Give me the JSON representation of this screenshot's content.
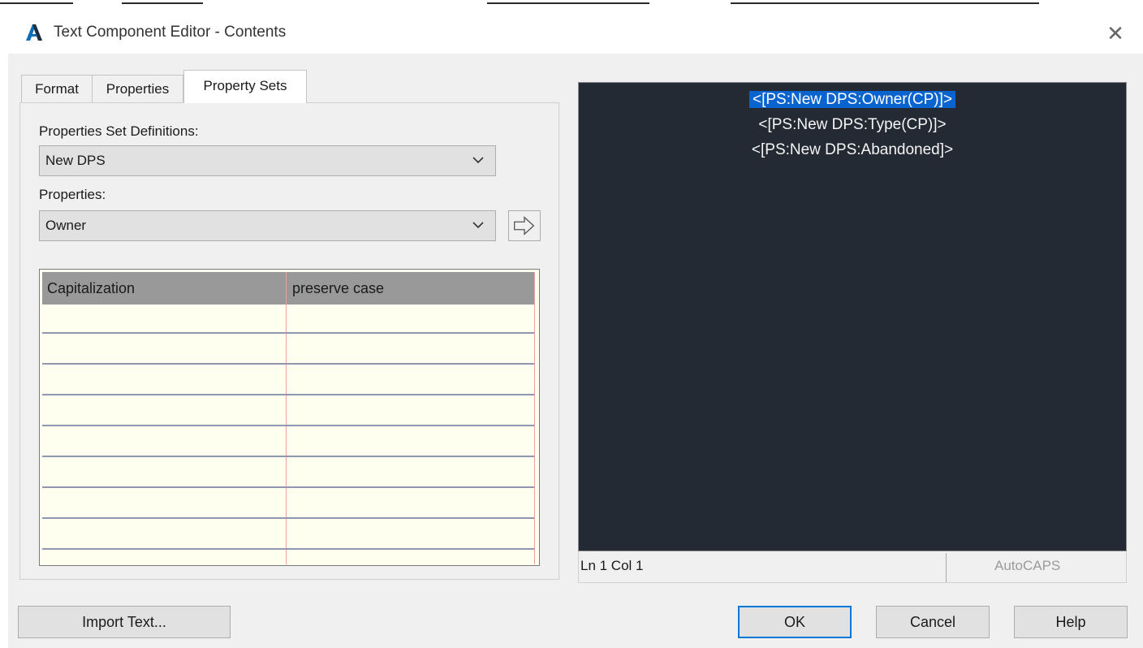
{
  "window": {
    "title": "Text Component Editor - Contents",
    "close_glyph": "✕"
  },
  "tabs": [
    {
      "label": "Format"
    },
    {
      "label": "Properties"
    },
    {
      "label": "Property Sets",
      "active": true
    }
  ],
  "property_sets": {
    "definitions_label": "Properties Set Definitions:",
    "definitions_value": "New DPS",
    "properties_label": "Properties:",
    "properties_value": "Owner",
    "table": {
      "col1_header": "Capitalization",
      "col2_header": "preserve case"
    }
  },
  "editor": {
    "lines": [
      "<[PS:New DPS:Owner(CP)]>",
      "<[PS:New DPS:Type(CP)]>",
      "<[PS:New DPS:Abandoned]>"
    ],
    "status_position": "Ln 1 Col 1",
    "status_caps": "AutoCAPS"
  },
  "buttons": {
    "import": "Import Text...",
    "ok": "OK",
    "cancel": "Cancel",
    "help": "Help"
  },
  "colors": {
    "editor_bg": "#232a33",
    "selection": "#0a64d0",
    "grid_bg": "#fffff0",
    "accent": "#0078d7"
  },
  "icons": {
    "app": "autodesk-a-icon",
    "close": "close-icon",
    "dropdown": "chevron-down-icon",
    "insert": "arrow-right-icon"
  }
}
